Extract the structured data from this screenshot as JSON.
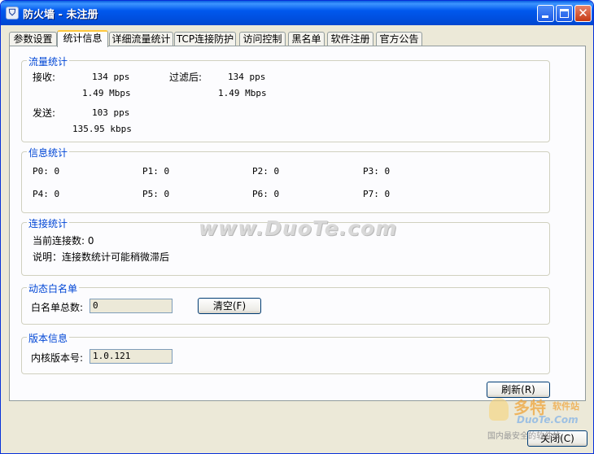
{
  "window": {
    "title": "防火墙 - 未注册"
  },
  "tabs": [
    {
      "label": "参数设置"
    },
    {
      "label": "统计信息"
    },
    {
      "label": "详细流量统计"
    },
    {
      "label": "TCP连接防护"
    },
    {
      "label": "访问控制"
    },
    {
      "label": "黑名单"
    },
    {
      "label": "软件注册"
    },
    {
      "label": "官方公告"
    }
  ],
  "traffic": {
    "title": "流量统计",
    "receive_label": "接收:",
    "receive_pps": "134 pps",
    "receive_mbps": "1.49 Mbps",
    "filtered_label": "过滤后:",
    "filtered_pps": "134 pps",
    "filtered_mbps": "1.49 Mbps",
    "send_label": "发送:",
    "send_pps": "103 pps",
    "send_kbps": "135.95 kbps"
  },
  "info": {
    "title": "信息统计",
    "p0": "P0: 0",
    "p1": "P1: 0",
    "p2": "P2: 0",
    "p3": "P3: 0",
    "p4": "P4: 0",
    "p5": "P5: 0",
    "p6": "P6: 0",
    "p7": "P7: 0"
  },
  "connections": {
    "title": "连接统计",
    "current_label": "当前连接数: 0",
    "note": "说明：连接数统计可能稍微滞后"
  },
  "whitelist": {
    "title": "动态白名单",
    "total_label": "白名单总数:",
    "total_value": "0",
    "clear_button": "清空(F)"
  },
  "version": {
    "title": "版本信息",
    "kernel_label": "内核版本号:",
    "kernel_value": "1.0.121"
  },
  "buttons": {
    "refresh": "刷新(R)",
    "close": "关闭(C)"
  },
  "watermark": {
    "site": "www.DuoTe.com",
    "logo_cn": "多特",
    "logo_soft": "软件站",
    "logo_en": "DuoTe.Com",
    "slogan": "国内最安全的软件站"
  },
  "colors": {
    "titlebar": "#0058ee",
    "group_title": "#0046d5",
    "window_bg": "#ece9d8"
  }
}
